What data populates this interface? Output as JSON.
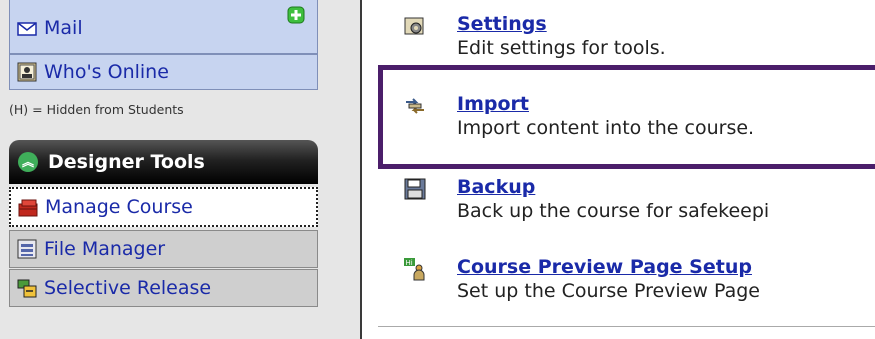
{
  "sidebar": {
    "items": [
      {
        "label": "Mail",
        "icon": "envelope-icon"
      },
      {
        "label": "Who's Online",
        "icon": "online-users-icon"
      }
    ],
    "hidden_note": "(H) = Hidden from Students",
    "designer_tools": {
      "title": "Designer Tools",
      "items": [
        {
          "label": "Manage Course",
          "icon": "toolbox-icon"
        },
        {
          "label": "File Manager",
          "icon": "file-manager-icon"
        },
        {
          "label": "Selective Release",
          "icon": "selective-release-icon"
        }
      ]
    },
    "colors": {
      "link": "#1a2aa8",
      "header_bg": "#222222",
      "accent_green": "#3fae5a"
    }
  },
  "tools": [
    {
      "name": "Settings",
      "description": "Edit settings for tools.",
      "icon": "settings-gear-icon"
    },
    {
      "name": "Import",
      "description": "Import content into the course.",
      "icon": "import-arrows-icon"
    },
    {
      "name": "Backup",
      "description": "Back up the course for safekeepi",
      "icon": "floppy-disk-icon"
    },
    {
      "name": "Course Preview Page Setup",
      "description": "Set up the Course Preview Page",
      "icon": "preview-page-icon"
    }
  ],
  "highlight_color": "#4b1e6a"
}
